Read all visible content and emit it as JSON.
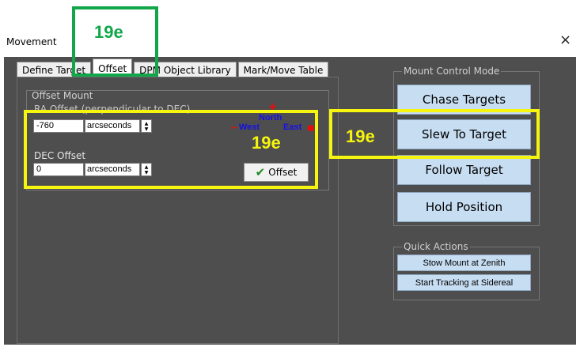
{
  "window": {
    "title": "Movement",
    "close_glyph": "×"
  },
  "tabs": [
    {
      "label": "Define Target",
      "active": false
    },
    {
      "label": "Offset",
      "active": true
    },
    {
      "label": "DPM Object Library",
      "active": false
    },
    {
      "label": "Mark/Move Table",
      "active": false
    }
  ],
  "offset_mount": {
    "group_title": "Offset Mount",
    "ra_label": "RA Offset (perpendicular to DEC)",
    "ra_value": "-760",
    "ra_unit": "arcseconds",
    "dec_label": "DEC Offset",
    "dec_value": "0",
    "dec_unit": "arcseconds",
    "compass": {
      "north": "North",
      "west": "West",
      "east": "East"
    },
    "offset_button": "Offset"
  },
  "mount_control": {
    "title": "Mount Control Mode",
    "buttons": [
      "Chase Targets",
      "Slew To Target",
      "Follow Target",
      "Hold Position"
    ]
  },
  "quick_actions": {
    "title": "Quick Actions",
    "buttons": [
      "Stow Mount at Zenith",
      "Start Tracking at Sidereal"
    ]
  },
  "annotations": {
    "green_label": "19e",
    "yellow_label_left": "19e",
    "yellow_label_right": "19e"
  },
  "colors": {
    "panel_bg": "#4e4e4e",
    "button_blue": "#c7ddf2",
    "highlight_yellow": "#f5f50f",
    "highlight_green": "#12a64b",
    "compass_blue": "#1410e6",
    "compass_red": "#e01010"
  }
}
